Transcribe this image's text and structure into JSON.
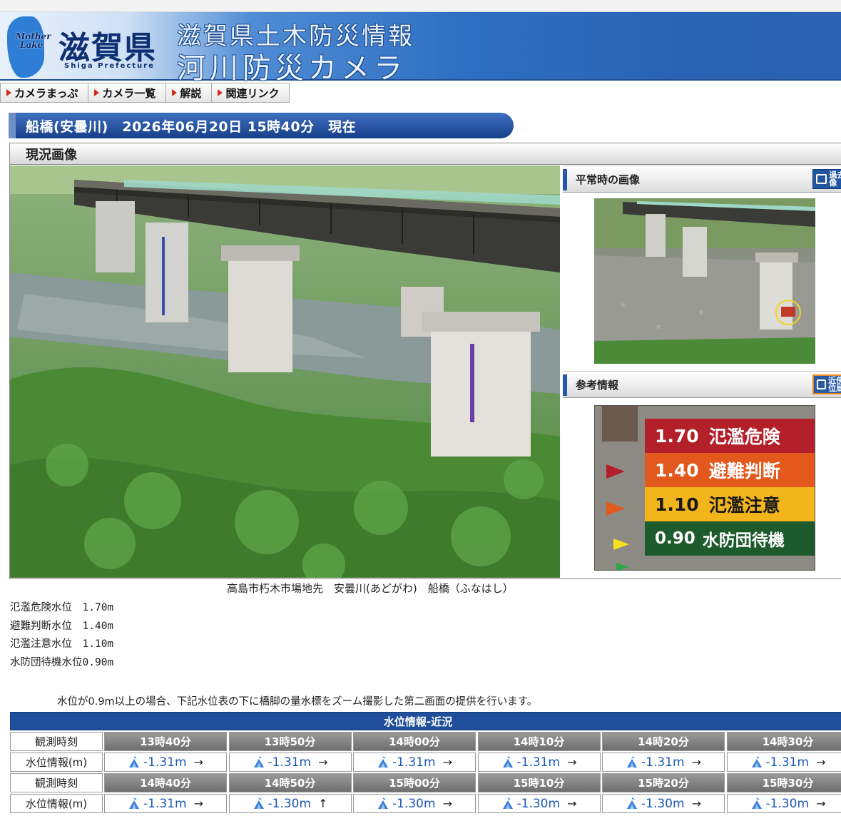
{
  "header": {
    "logo_mother": "Mother",
    "logo_lake": "Lake",
    "logo_kanji": "滋賀県",
    "logo_roman": "Shiga Prefecture",
    "title_line1": "滋賀県土木防災情報",
    "title_line2": "河川防災カメラ"
  },
  "nav": {
    "items": [
      {
        "label": "カメラまっぷ"
      },
      {
        "label": "カメラ一覧"
      },
      {
        "label": "解説"
      },
      {
        "label": "関連リンク"
      }
    ]
  },
  "status": {
    "text": "船橋(安曇川)　2026年06月20日 15時40分　現在"
  },
  "current_image": {
    "heading": "現況画像"
  },
  "side": {
    "normal_heading": "平常時の画像",
    "normal_button": "過去画像",
    "reference_heading": "参考情報",
    "reference_button": "近傍水位局"
  },
  "gauge_sign": {
    "rows": [
      {
        "value": "1.70",
        "label": "氾濫危険",
        "color": "#b3202a"
      },
      {
        "value": "1.40",
        "label": "避難判断",
        "color": "#e2581d"
      },
      {
        "value": "1.10",
        "label": "氾濫注意",
        "color": "#f2b51c"
      },
      {
        "value": "0.90",
        "label": "水防団待機",
        "color": "#1d5a2c"
      }
    ]
  },
  "caption": "高島市朽木市場地先　安曇川(あどがわ)　船橋（ふなはし）",
  "levels": [
    "氾濫危険水位　1.70m",
    "避難判断水位　1.40m",
    "氾濫注意水位　1.10m",
    "水防団待機水位0.90m"
  ],
  "notice": "水位が0.9m以上の場合、下記水位表の下に橋脚の量水標をズーム撮影した第二画面の提供を行います。",
  "water_table": {
    "title": "水位情報-近況",
    "time_label": "観測時刻",
    "value_label": "水位情報(m)",
    "rows": [
      {
        "times": [
          "13時40分",
          "13時50分",
          "14時00分",
          "14時10分",
          "14時20分",
          "14時30分"
        ],
        "values": [
          "-1.31m",
          "-1.31m",
          "-1.31m",
          "-1.31m",
          "-1.31m",
          "-1.31m"
        ],
        "trends": [
          "→",
          "→",
          "→",
          "→",
          "→",
          "→"
        ]
      },
      {
        "times": [
          "14時40分",
          "14時50分",
          "15時00分",
          "15時10分",
          "15時20分",
          "15時30分"
        ],
        "values": [
          "-1.31m",
          "-1.30m",
          "-1.30m",
          "-1.30m",
          "-1.30m",
          "-1.30m"
        ],
        "trends": [
          "→",
          "↑",
          "→",
          "→",
          "→",
          "→"
        ]
      }
    ]
  }
}
